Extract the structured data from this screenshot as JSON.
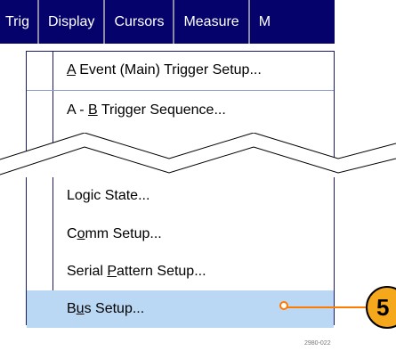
{
  "menubar": {
    "items": [
      "Trig",
      "Display",
      "Cursors",
      "Measure",
      "M"
    ]
  },
  "dropdown": {
    "items": [
      {
        "pre": "",
        "mn": "A",
        "post": " Event (Main) Trigger Setup..."
      },
      {
        "pre": "A - ",
        "mn": "B",
        "post": " Trigger Sequence..."
      },
      {
        "pre": "Lo",
        "mn": "g",
        "post": "ic State..."
      },
      {
        "pre": "C",
        "mn": "o",
        "post": "mm Setup..."
      },
      {
        "pre": "Serial ",
        "mn": "P",
        "post": "attern Setup..."
      },
      {
        "pre": "B",
        "mn": "u",
        "post": "s Setup..."
      }
    ],
    "selected_index": 5
  },
  "callout": {
    "number": "5"
  },
  "figure_code": "2980-022",
  "colors": {
    "menubar_bg": "#05036b",
    "highlight": "#bad8f4",
    "callout_fill": "#f6a81d",
    "pointer": "#ff7a00"
  }
}
